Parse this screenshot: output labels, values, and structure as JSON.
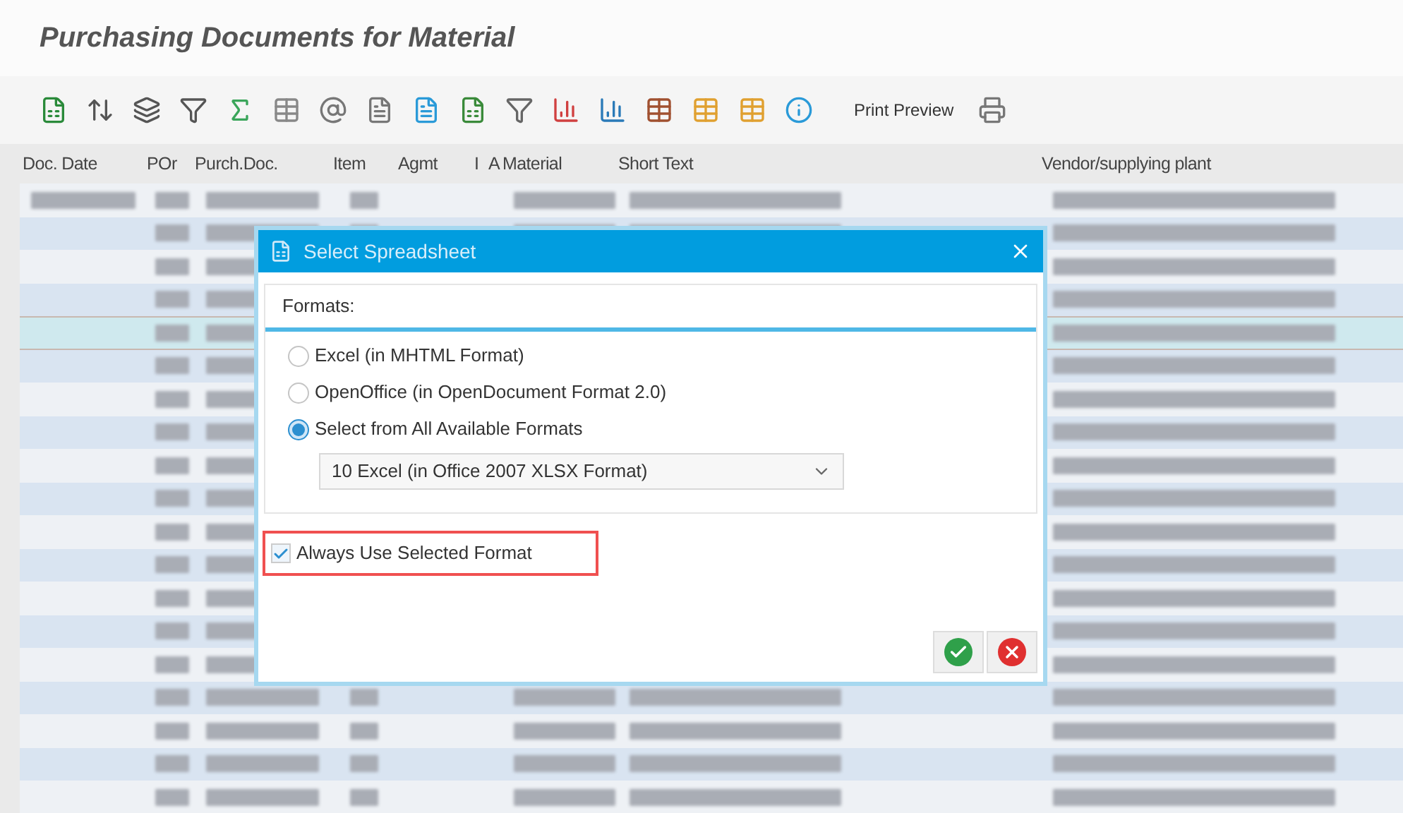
{
  "window": {
    "title": "Purchasing Documents for Material"
  },
  "toolbar": {
    "print_preview": "Print Preview"
  },
  "table": {
    "columns": [
      "Doc. Date",
      "POr",
      "Purch.Doc.",
      "Item",
      "Agmt",
      "I",
      "A",
      "Material",
      "Short Text",
      "Vendor/supplying plant"
    ],
    "rows": [
      {
        "selected": false
      },
      {
        "selected": false
      },
      {
        "selected": false
      },
      {
        "selected": false
      },
      {
        "selected": true
      },
      {
        "selected": false
      },
      {
        "selected": false
      },
      {
        "selected": false
      },
      {
        "selected": false
      },
      {
        "selected": false
      },
      {
        "selected": false
      },
      {
        "selected": false
      },
      {
        "selected": false
      },
      {
        "selected": false
      },
      {
        "selected": false
      },
      {
        "selected": false
      },
      {
        "selected": false
      },
      {
        "selected": false
      },
      {
        "selected": false
      }
    ]
  },
  "dialog": {
    "title": "Select Spreadsheet",
    "group_label": "Formats:",
    "options": [
      {
        "label": "Excel (in MHTML Format)",
        "selected": false
      },
      {
        "label": "OpenOffice (in OpenDocument Format 2.0)",
        "selected": false
      },
      {
        "label": "Select from All Available Formats",
        "selected": true
      }
    ],
    "format_dropdown": {
      "value": "10 Excel (in Office 2007 XLSX Format)"
    },
    "always_use": {
      "label": "Always Use Selected Format",
      "checked": true
    }
  }
}
